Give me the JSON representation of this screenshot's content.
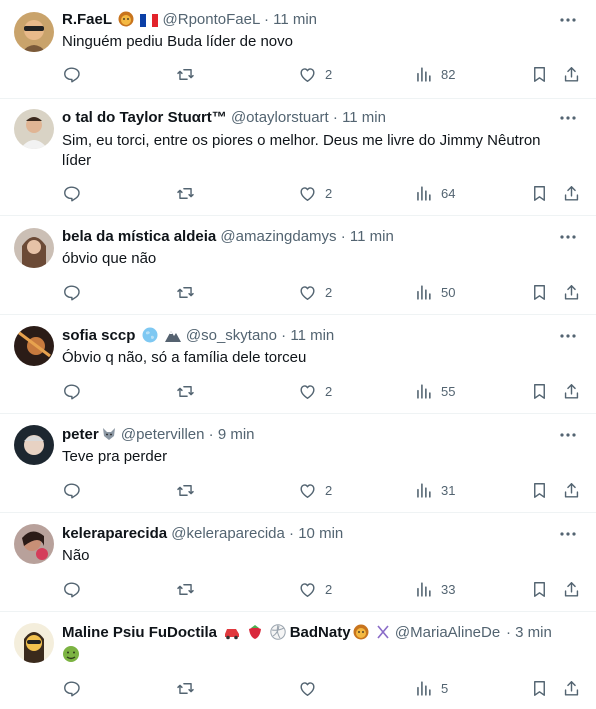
{
  "tweets": [
    {
      "name": "R.FaeL",
      "handle": "@RpontoFaeL",
      "time": "11 min",
      "text": "Ninguém pediu Buda líder de novo",
      "text2": "",
      "likes": "2",
      "views": "82",
      "name_emojis": [
        "lion-face",
        "flag-france"
      ]
    },
    {
      "name": "o tal do Taylor Stuαrt™",
      "handle": "@otaylorstuart",
      "time": "11 min",
      "text": "Sim, eu torci, entre os piores o melhor. Deus me livre do Jimmy Nêutron",
      "text2": "líder",
      "likes": "2",
      "views": "64",
      "name_emojis": []
    },
    {
      "name": "bela da mística aldeia",
      "handle": "@amazingdamys",
      "time": "11 min",
      "text": "óbvio que não",
      "text2": "",
      "likes": "2",
      "views": "50",
      "name_emojis": []
    },
    {
      "name": "sofia sccp",
      "handle": "@so_skytano",
      "time": "11 min",
      "text": "Óbvio q não, só a família dele torceu",
      "text2": "",
      "likes": "2",
      "views": "55",
      "name_emojis": [
        "globe",
        "mountain"
      ]
    },
    {
      "name": "peter",
      "handle": "@petervillen",
      "time": "9 min",
      "text": "Teve pra perder",
      "text2": "",
      "likes": "2",
      "views": "31",
      "name_emojis": [
        "wolf"
      ]
    },
    {
      "name": "keleraparecida",
      "handle": "@keleraparecida",
      "time": "10 min",
      "text": "Não",
      "text2": "",
      "likes": "2",
      "views": "33",
      "name_emojis": []
    },
    {
      "name": "Maline Psiu FuDoctila",
      "name_suffix": "BadNaty",
      "handle": "@MariaAlineDe",
      "time": "3 min",
      "text": "",
      "text2": "",
      "likes": "",
      "views": "5",
      "name_emojis": [
        "car",
        "strawberry",
        "volleyball",
        "lion-face",
        "dna"
      ],
      "body_emoji": "nauseated-face"
    }
  ],
  "meta_sep": "·",
  "colors": {
    "text": "#0f1419",
    "secondary": "#536471",
    "divider": "#eff3f4"
  }
}
